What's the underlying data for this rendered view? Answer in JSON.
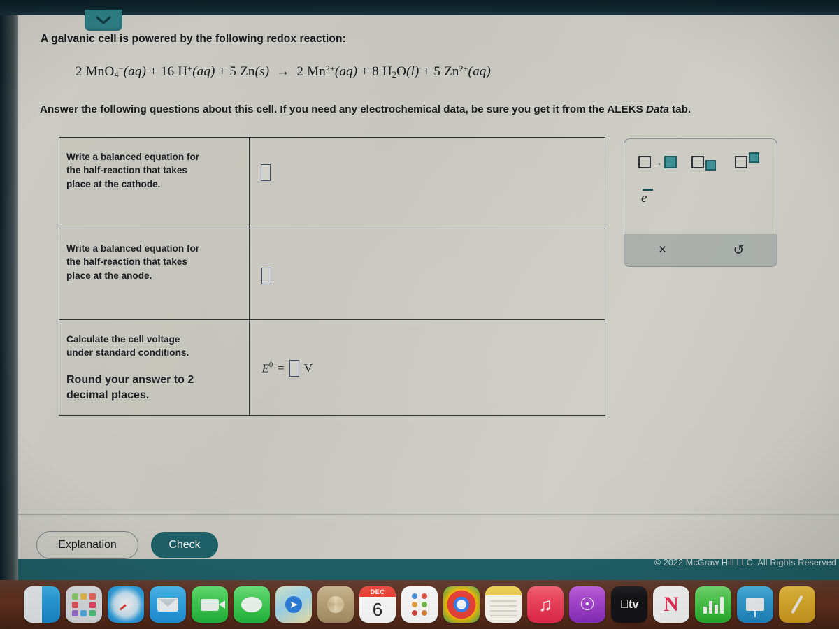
{
  "tab": {
    "icon": "chevron-down-icon"
  },
  "prompt": {
    "line1": "A galvanic cell is powered by the following redox reaction:",
    "instruction_pre": "Answer the following questions about this cell. If you need any electrochemical data, be sure you get it from the ALEKS ",
    "instruction_em": "Data",
    "instruction_post": " tab."
  },
  "equation": {
    "full": "2 MnO4-(aq) + 16 H+(aq) + 5 Zn(s) → 2 Mn2+(aq) + 8 H2O(l) + 5 Zn2+(aq)",
    "terms": {
      "t1_coef": "2",
      "t1_species": "MnO",
      "t1_sub": "4",
      "t1_charge": "−",
      "t1_state": "(aq)",
      "t2_coef": "16",
      "t2_species": "H",
      "t2_charge": "+",
      "t2_state": "(aq)",
      "t3_coef": "5",
      "t3_species": "Zn",
      "t3_state": "(s)",
      "arrow": "→",
      "t4_coef": "2",
      "t4_species": "Mn",
      "t4_charge": "2+",
      "t4_state": "(aq)",
      "t5_coef": "8",
      "t5_species_a": "H",
      "t5_sub": "2",
      "t5_species_b": "O",
      "t5_state": "(l)",
      "t6_coef": "5",
      "t6_species": "Zn",
      "t6_charge": "2+",
      "t6_state": "(aq)",
      "plus": "+"
    }
  },
  "table": {
    "rows": [
      {
        "question_line1": "Write a balanced equation for",
        "question_line2": "the half-reaction that takes",
        "question_line3": "place at the cathode.",
        "answer_type": "empty-input-box"
      },
      {
        "question_line1": "Write a balanced equation for",
        "question_line2": "the half-reaction that takes",
        "question_line3": "place at the anode.",
        "answer_type": "empty-input-box"
      },
      {
        "question_line1": "Calculate the cell voltage",
        "question_line2": "under standard conditions.",
        "question_line3": "Round your answer to 2",
        "question_line4": "decimal places.",
        "answer_type": "voltage-equation",
        "voltage": {
          "symbol": "E",
          "superscript": "0",
          "equals": "=",
          "value": "",
          "unit": "V"
        }
      }
    ]
  },
  "palette": {
    "buttons": [
      {
        "name": "reaction-arrow-icon",
        "label": "→"
      },
      {
        "name": "subscript-icon",
        "label": "subscript"
      },
      {
        "name": "superscript-icon",
        "label": "superscript"
      }
    ],
    "electron": "e",
    "electron_charge": "−",
    "footer": {
      "clear": "×",
      "undo": "↺"
    }
  },
  "footer": {
    "explanation_label": "Explanation",
    "check_label": "Check",
    "copyright": "© 2022 McGraw Hill LLC. All Rights Reserved"
  },
  "colors": {
    "teal_accent": "#1f6169",
    "tab_teal": "#2f8088",
    "page_bg": "#cfcec7",
    "palette_chip": "#3e9298",
    "calendar_red": "#ef4236"
  },
  "dock": {
    "items": [
      {
        "name": "finder-icon",
        "label": "Finder"
      },
      {
        "name": "launchpad-icon",
        "label": "Launchpad"
      },
      {
        "name": "safari-icon",
        "label": "Safari"
      },
      {
        "name": "mail-icon",
        "label": "Mail"
      },
      {
        "name": "facetime-icon",
        "label": "FaceTime"
      },
      {
        "name": "messages-icon",
        "label": "Messages"
      },
      {
        "name": "maps-icon",
        "label": "Maps"
      },
      {
        "name": "photos-icon",
        "label": "Photos"
      },
      {
        "name": "calendar-icon",
        "label": "Calendar",
        "month": "DEC",
        "day": "6"
      },
      {
        "name": "contacts-icon",
        "label": "Contacts"
      },
      {
        "name": "chrome-icon",
        "label": "Chrome"
      },
      {
        "name": "notes-icon",
        "label": "Notes"
      },
      {
        "name": "music-icon",
        "label": "Music"
      },
      {
        "name": "podcasts-icon",
        "label": "Podcasts"
      },
      {
        "name": "apple-tv-icon",
        "label": "tv"
      },
      {
        "name": "news-icon",
        "label": "News"
      },
      {
        "name": "numbers-icon",
        "label": "Numbers"
      },
      {
        "name": "keynote-icon",
        "label": "Keynote"
      },
      {
        "name": "pages-icon",
        "label": "Pages"
      }
    ]
  }
}
